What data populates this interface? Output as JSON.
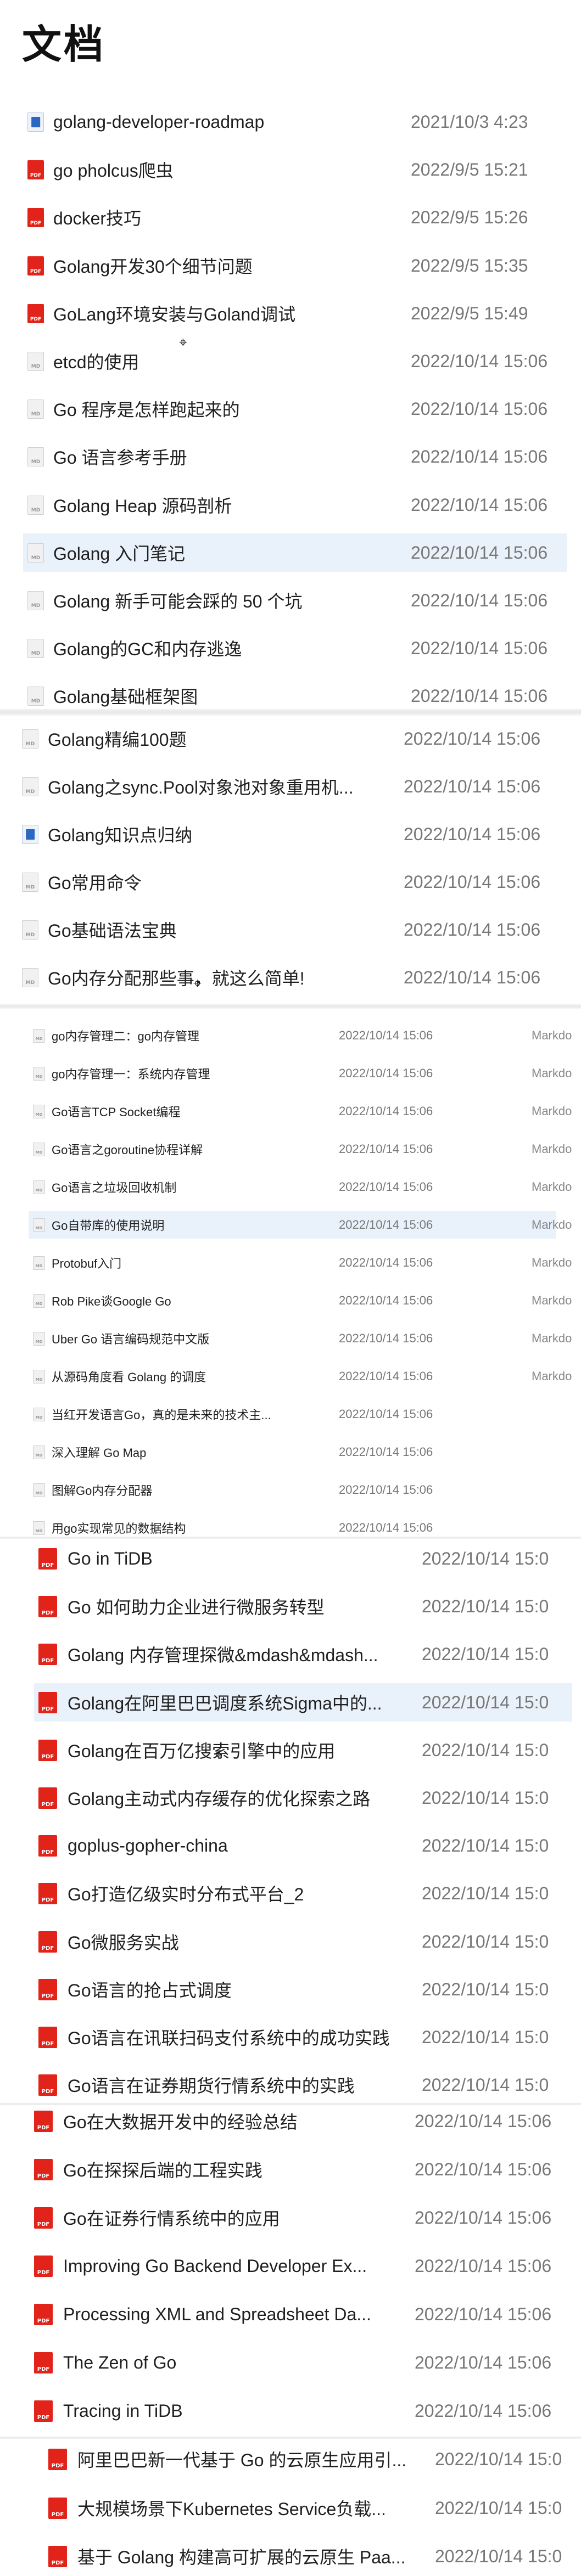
{
  "page_title": "文档",
  "rows": [
    {
      "name": "golang-developer-roadmap",
      "date": "2021/10/3 4:23",
      "type": "",
      "icon": "doc",
      "selected": false
    },
    {
      "name": "go pholcus爬虫",
      "date": "2022/9/5 15:21",
      "type": "",
      "icon": "pdf",
      "selected": false
    },
    {
      "name": "docker技巧",
      "date": "2022/9/5 15:26",
      "type": "",
      "icon": "pdf",
      "selected": false
    },
    {
      "name": "Golang开发30个细节问题",
      "date": "2022/9/5 15:35",
      "type": "",
      "icon": "pdf",
      "selected": false
    },
    {
      "name": "GoLang环境安装与Goland调试",
      "date": "2022/9/5 15:49",
      "type": "",
      "icon": "pdf",
      "selected": false
    },
    {
      "name": "etcd的使用",
      "date": "2022/10/14 15:06",
      "type": "",
      "icon": "md",
      "selected": false
    },
    {
      "name": "Go 程序是怎样跑起来的",
      "date": "2022/10/14 15:06",
      "type": "",
      "icon": "md",
      "selected": false
    },
    {
      "name": "Go 语言参考手册",
      "date": "2022/10/14 15:06",
      "type": "",
      "icon": "md",
      "selected": false
    },
    {
      "name": "Golang Heap 源码剖析",
      "date": "2022/10/14 15:06",
      "type": "",
      "icon": "md",
      "selected": false
    },
    {
      "name": "Golang 入门笔记",
      "date": "2022/10/14 15:06",
      "type": "",
      "icon": "md",
      "selected": true
    },
    {
      "name": "Golang 新手可能会踩的 50 个坑",
      "date": "2022/10/14 15:06",
      "type": "",
      "icon": "md",
      "selected": false
    },
    {
      "name": "Golang的GC和内存逃逸",
      "date": "2022/10/14 15:06",
      "type": "",
      "icon": "md",
      "selected": false
    },
    {
      "name": "Golang基础框架图",
      "date": "2022/10/14 15:06",
      "type": "",
      "icon": "md",
      "selected": false
    },
    {
      "name": "Golang精编100题",
      "date": "2022/10/14 15:06",
      "type": "",
      "icon": "md",
      "selected": false
    },
    {
      "name": "Golang之sync.Pool对象池对象重用机...",
      "date": "2022/10/14 15:06",
      "type": "",
      "icon": "md",
      "selected": false
    },
    {
      "name": "Golang知识点归纳",
      "date": "2022/10/14 15:06",
      "type": "",
      "icon": "doc",
      "selected": false
    },
    {
      "name": "Go常用命令",
      "date": "2022/10/14 15:06",
      "type": "",
      "icon": "md",
      "selected": false
    },
    {
      "name": "Go基础语法宝典",
      "date": "2022/10/14 15:06",
      "type": "",
      "icon": "md",
      "selected": false
    },
    {
      "name": "Go内存分配那些事，就这么简单!",
      "date": "2022/10/14 15:06",
      "type": "",
      "icon": "md",
      "selected": false
    },
    {
      "name": "go内存管理二：go内存管理",
      "date": "2022/10/14 15:06",
      "type": "Markdo",
      "icon": "md",
      "selected": false
    },
    {
      "name": "go内存管理一：系统内存管理",
      "date": "2022/10/14 15:06",
      "type": "Markdo",
      "icon": "md",
      "selected": false
    },
    {
      "name": "Go语言TCP Socket编程",
      "date": "2022/10/14 15:06",
      "type": "Markdo",
      "icon": "md",
      "selected": false
    },
    {
      "name": "Go语言之goroutine协程详解",
      "date": "2022/10/14 15:06",
      "type": "Markdo",
      "icon": "md",
      "selected": false
    },
    {
      "name": "Go语言之垃圾回收机制",
      "date": "2022/10/14 15:06",
      "type": "Markdo",
      "icon": "md",
      "selected": false
    },
    {
      "name": "Go自带库的使用说明",
      "date": "2022/10/14 15:06",
      "type": "Markdo",
      "icon": "md",
      "selected": true
    },
    {
      "name": "Protobuf入门",
      "date": "2022/10/14 15:06",
      "type": "Markdo",
      "icon": "md",
      "selected": false
    },
    {
      "name": "Rob Pike谈Google Go",
      "date": "2022/10/14 15:06",
      "type": "Markdo",
      "icon": "md",
      "selected": false
    },
    {
      "name": "Uber Go 语言编码规范中文版",
      "date": "2022/10/14 15:06",
      "type": "Markdo",
      "icon": "md",
      "selected": false
    },
    {
      "name": "从源码角度看 Golang 的调度",
      "date": "2022/10/14 15:06",
      "type": "Markdo",
      "icon": "md",
      "selected": false
    },
    {
      "name": "当红开发语言Go，真的是未来的技术主...",
      "date": "2022/10/14 15:06",
      "type": "",
      "icon": "md",
      "selected": false
    },
    {
      "name": "深入理解 Go Map",
      "date": "2022/10/14 15:06",
      "type": "",
      "icon": "md",
      "selected": false
    },
    {
      "name": "图解Go内存分配器",
      "date": "2022/10/14 15:06",
      "type": "",
      "icon": "md",
      "selected": false
    },
    {
      "name": "用go实现常见的数据结构",
      "date": "2022/10/14 15:06",
      "type": "",
      "icon": "md",
      "selected": false
    },
    {
      "name": "Go in TiDB",
      "date": "2022/10/14 15:0",
      "type": "",
      "icon": "pdf",
      "selected": false
    },
    {
      "name": "Go 如何助力企业进行微服务转型",
      "date": "2022/10/14 15:0",
      "type": "",
      "icon": "pdf",
      "selected": false
    },
    {
      "name": "Golang 内存管理探微&mdash&mdash...",
      "date": "2022/10/14 15:0",
      "type": "",
      "icon": "pdf",
      "selected": false
    },
    {
      "name": "Golang在阿里巴巴调度系统Sigma中的...",
      "date": "2022/10/14 15:0",
      "type": "",
      "icon": "pdf",
      "selected": true
    },
    {
      "name": "Golang在百万亿搜索引擎中的应用",
      "date": "2022/10/14 15:0",
      "type": "",
      "icon": "pdf",
      "selected": false
    },
    {
      "name": "Golang主动式内存缓存的优化探索之路",
      "date": "2022/10/14 15:0",
      "type": "",
      "icon": "pdf",
      "selected": false
    },
    {
      "name": "goplus-gopher-china",
      "date": "2022/10/14 15:0",
      "type": "",
      "icon": "pdf",
      "selected": false
    },
    {
      "name": "Go打造亿级实时分布式平台_2",
      "date": "2022/10/14 15:0",
      "type": "",
      "icon": "pdf",
      "selected": false
    },
    {
      "name": "Go微服务实战",
      "date": "2022/10/14 15:0",
      "type": "",
      "icon": "pdf",
      "selected": false
    },
    {
      "name": "Go语言的抢占式调度",
      "date": "2022/10/14 15:0",
      "type": "",
      "icon": "pdf",
      "selected": false
    },
    {
      "name": "Go语言在讯联扫码支付系统中的成功实践",
      "date": "2022/10/14 15:0",
      "type": "",
      "icon": "pdf",
      "selected": false
    },
    {
      "name": "Go语言在证券期货行情系统中的实践",
      "date": "2022/10/14 15:0",
      "type": "",
      "icon": "pdf",
      "selected": false
    },
    {
      "name": "Go在大数据开发中的经验总结",
      "date": "2022/10/14 15:06",
      "type": "",
      "icon": "pdf",
      "selected": false
    },
    {
      "name": "Go在探探后端的工程实践",
      "date": "2022/10/14 15:06",
      "type": "",
      "icon": "pdf",
      "selected": false
    },
    {
      "name": "Go在证券行情系统中的应用",
      "date": "2022/10/14 15:06",
      "type": "",
      "icon": "pdf",
      "selected": false
    },
    {
      "name": "Improving Go Backend Developer Ex...",
      "date": "2022/10/14 15:06",
      "type": "",
      "icon": "pdf",
      "selected": false
    },
    {
      "name": "Processing XML and Spreadsheet Da...",
      "date": "2022/10/14 15:06",
      "type": "",
      "icon": "pdf",
      "selected": false
    },
    {
      "name": "The Zen of Go",
      "date": "2022/10/14 15:06",
      "type": "",
      "icon": "pdf",
      "selected": false
    },
    {
      "name": "Tracing in TiDB",
      "date": "2022/10/14 15:06",
      "type": "",
      "icon": "pdf",
      "selected": false
    },
    {
      "name": "阿里巴巴新一代基于 Go 的云原生应用引...",
      "date": "2022/10/14 15:0",
      "type": "",
      "icon": "pdf",
      "selected": false
    },
    {
      "name": "大规模场景下Kubernetes Service负载...",
      "date": "2022/10/14 15:0",
      "type": "",
      "icon": "pdf",
      "selected": false
    },
    {
      "name": "基于 Golang 构建高可扩展的云原生 Paa...",
      "date": "2022/10/14 15:0",
      "type": "",
      "icon": "pdf",
      "selected": false
    }
  ]
}
